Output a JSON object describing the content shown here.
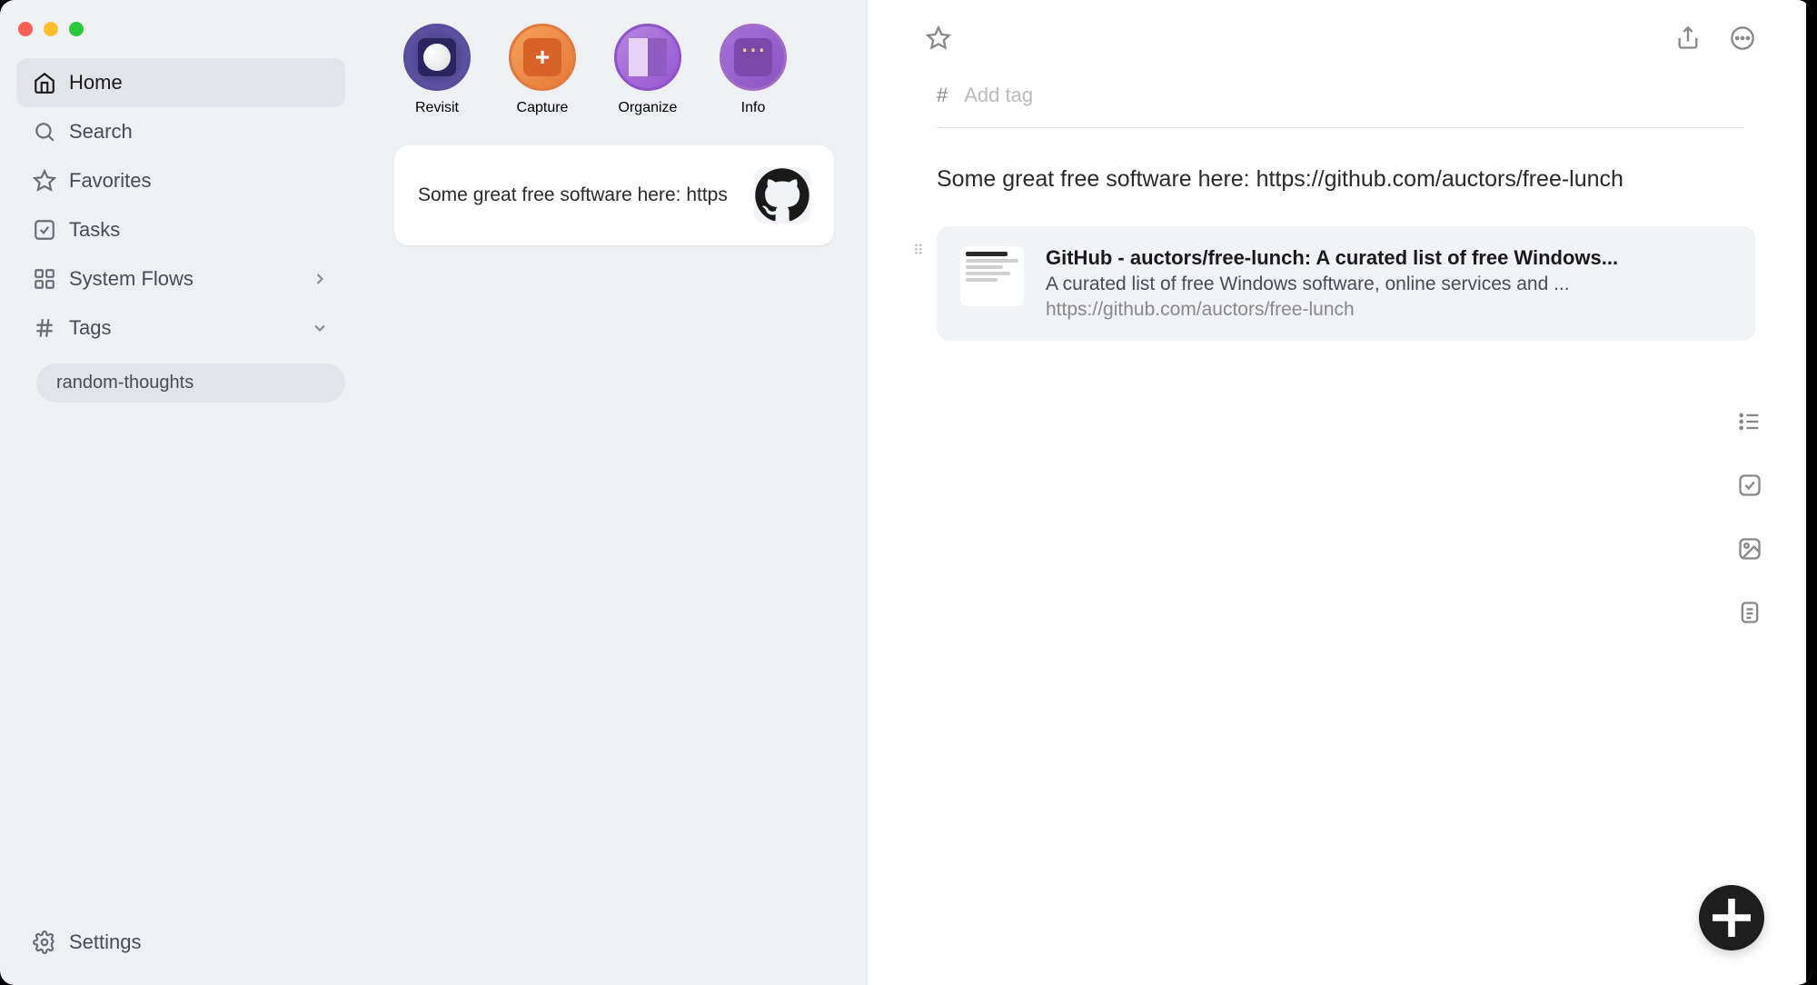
{
  "sidebar": {
    "home": "Home",
    "search": "Search",
    "favorites": "Favorites",
    "tasks": "Tasks",
    "system_flows": "System Flows",
    "tags": "Tags",
    "tag_pill": "random-thoughts",
    "settings": "Settings"
  },
  "categories": {
    "revisit": "Revisit",
    "capture": "Capture",
    "organize": "Organize",
    "info": "Info"
  },
  "note_card": {
    "text": "Some great free software here: https"
  },
  "detail": {
    "tag_placeholder": "Add tag",
    "note_text": "Some great free software here: https://github.com/auctors/free-lunch",
    "link": {
      "title": "GitHub - auctors/free-lunch: A curated list of free Windows...",
      "description": "A curated list of free Windows software, online services and ...",
      "url": "https://github.com/auctors/free-lunch"
    }
  }
}
